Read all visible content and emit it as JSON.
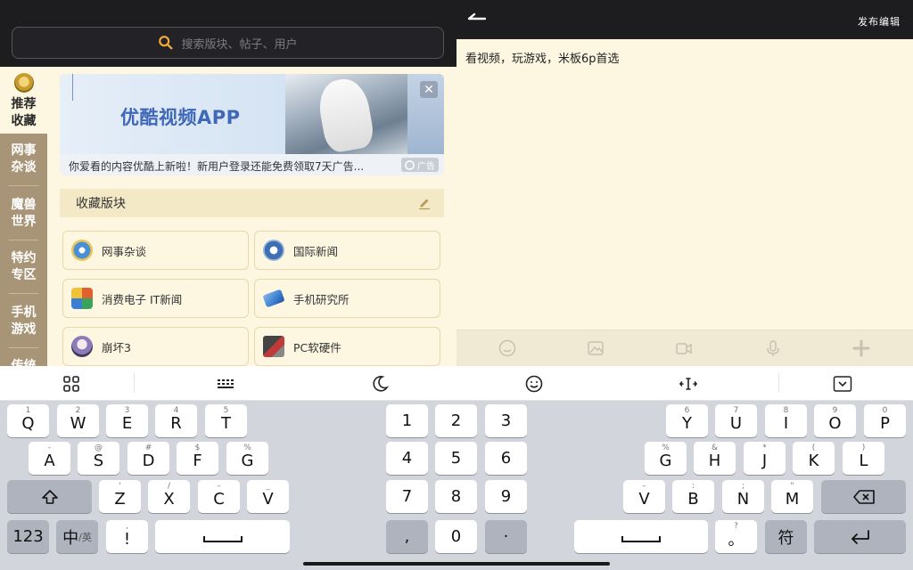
{
  "search": {
    "placeholder": "搜索版块、帖子、用户"
  },
  "sidebar": {
    "items": [
      {
        "label_line1": "推荐",
        "label_line2": "收藏"
      },
      {
        "label_line1": "网事",
        "label_line2": "杂谈"
      },
      {
        "label_line1": "魔兽",
        "label_line2": "世界"
      },
      {
        "label_line1": "特约",
        "label_line2": "专区"
      },
      {
        "label_line1": "手机",
        "label_line2": "游戏"
      },
      {
        "label_line1": "传统",
        "label_line2": ""
      }
    ]
  },
  "banner": {
    "title": "优酷视频APP",
    "text": "你爱看的内容优酷上新啦！新用户登录还能免费领取7天广告...",
    "ad_label": "广告",
    "close_symbol": "✕"
  },
  "favorites": {
    "title": "收藏版块",
    "boards": [
      {
        "label": "网事杂谈",
        "icon": "wangshi-icon",
        "color": "#4a8fd6"
      },
      {
        "label": "国际新闻",
        "icon": "news-icon",
        "color": "#3d6fb5"
      },
      {
        "label": "消费电子 IT新闻",
        "icon": "electronics-icon",
        "color": "#e0602f"
      },
      {
        "label": "手机研究所",
        "icon": "phone-icon",
        "color": "#3a7fd0"
      },
      {
        "label": "崩坏3",
        "icon": "honkai-icon",
        "color": "#8b7bb8"
      },
      {
        "label": "PC软硬件",
        "icon": "pc-icon",
        "color": "#c03a3a"
      }
    ]
  },
  "editor": {
    "title": "发布编辑",
    "content": "看视频，玩游戏，米板6p首选"
  },
  "keyboard": {
    "row1": [
      {
        "sup": "1",
        "key": "Q"
      },
      {
        "sup": "2",
        "key": "W"
      },
      {
        "sup": "3",
        "key": "E"
      },
      {
        "sup": "4",
        "key": "R"
      },
      {
        "sup": "5",
        "key": "T"
      }
    ],
    "row1r": [
      {
        "sup": "6",
        "key": "Y"
      },
      {
        "sup": "7",
        "key": "U"
      },
      {
        "sup": "8",
        "key": "I"
      },
      {
        "sup": "9",
        "key": "O"
      },
      {
        "sup": "0",
        "key": "P"
      }
    ],
    "row2": [
      {
        "sup": "-",
        "key": "A"
      },
      {
        "sup": "@",
        "key": "S"
      },
      {
        "sup": "#",
        "key": "D"
      },
      {
        "sup": "$",
        "key": "F"
      },
      {
        "sup": "%",
        "key": "G"
      }
    ],
    "row2r": [
      {
        "sup": "%",
        "key": "G"
      },
      {
        "sup": "&",
        "key": "H"
      },
      {
        "sup": "*",
        "key": "J"
      },
      {
        "sup": "(",
        "key": "K"
      },
      {
        "sup": ")",
        "key": "L"
      }
    ],
    "row3": [
      {
        "sup": "'",
        "key": "Z"
      },
      {
        "sup": "/",
        "key": "X"
      },
      {
        "sup": "–",
        "key": "C"
      },
      {
        "sup": "_",
        "key": "V"
      }
    ],
    "row3r": [
      {
        "sup": "–",
        "key": "V"
      },
      {
        "sup": ":",
        "key": "B"
      },
      {
        "sup": ";",
        "key": "N"
      },
      {
        "sup": "\"",
        "key": "M"
      }
    ],
    "numpad": [
      "1",
      "2",
      "3",
      "4",
      "5",
      "6",
      "7",
      "8",
      "9"
    ],
    "num_comma": ",",
    "num_zero": "0",
    "num_dot": "·",
    "key_123": "123",
    "key_lang_main": "中",
    "key_lang_sub": "/英",
    "punct_left_sup": ",",
    "punct_left_main": "!",
    "punct_right_sup": "?",
    "punct_right_main": "。",
    "key_fu": "符"
  }
}
